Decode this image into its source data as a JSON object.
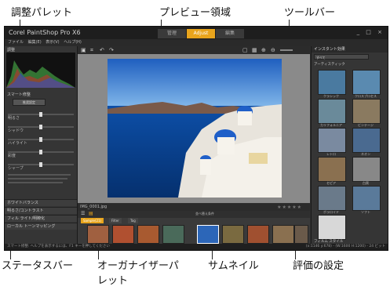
{
  "callouts": {
    "adjust_palette": "調整パレット",
    "preview_area": "プレビュー領域",
    "toolbar": "ツールバー",
    "status_bar": "ステータスバー",
    "organizer_palette_line1": "オーガナイザーパ",
    "organizer_palette_line2": "レット",
    "thumbnail": "サムネイル",
    "rating": "評価の設定"
  },
  "app": {
    "title": "Corel PaintShop Pro X6",
    "mode_tabs": [
      "管理",
      "Adjust",
      "編集"
    ],
    "window_controls": "_ □ ×",
    "menu": [
      "ファイル",
      "編集(E)",
      "表示(V)",
      "ヘルプ(H)"
    ]
  },
  "left_palette": {
    "title": "調整",
    "section_smart": "スマート修整",
    "button_suggest": "推奨設定",
    "sliders": [
      {
        "label": "明るさ",
        "value": 0.5
      },
      {
        "label": "シャドウ",
        "value": 0.5
      },
      {
        "label": "ハイライト",
        "value": 0.5
      },
      {
        "label": "彩度",
        "value": 0.5
      },
      {
        "label": "シャープ",
        "value": 0.5
      }
    ],
    "sections": [
      "ホワイトバランス",
      "明るさ/コントラスト",
      "フィル ライト/明瞭化",
      "ローカル トーンマッピング"
    ]
  },
  "organizer": {
    "tabs": [
      "Sample(21)",
      "Filter",
      "Tag"
    ],
    "filename": "IMG_0001.jpg",
    "rating_stars": "★★★★★",
    "sort_label": "並べ替え条件",
    "thumbnails_count": 9
  },
  "right_palette": {
    "title": "インスタント効果",
    "dropdown": "すべて",
    "category": "アーティスティック",
    "items": [
      "クラシック",
      "クロスプロセス",
      "カリフォルニア",
      "ビンテージ",
      "レトロ",
      "ネオン",
      "セピア",
      "白黒",
      "ポラロイド",
      "ソフト"
    ],
    "footer": "フィルム スタイル"
  },
  "status_text": "スマート修整: ヘルプを表示するには、F1 キーを押してください",
  "status_right": "(x:1146 y:678) - (W:1600 H:1200) - 24 ビット",
  "colors": {
    "accent": "#e8a41c",
    "background": "#2f2f2f"
  }
}
